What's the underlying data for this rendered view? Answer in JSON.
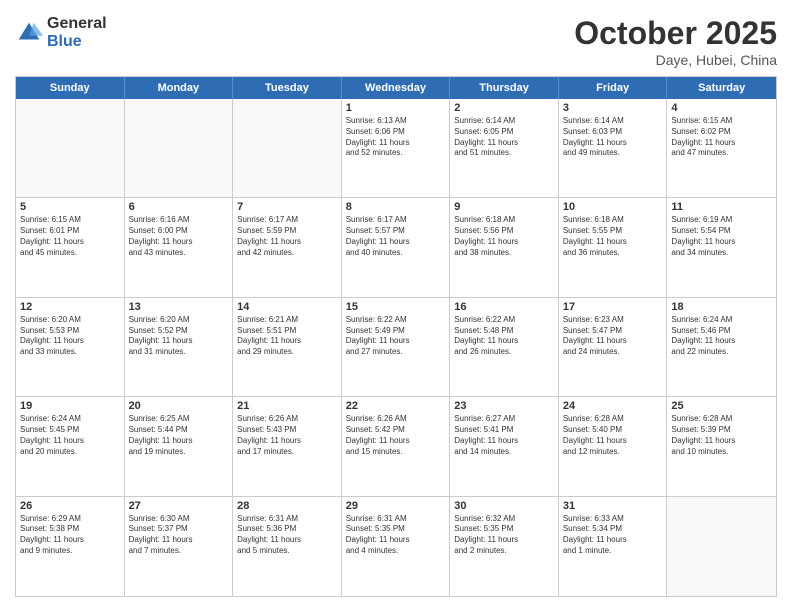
{
  "header": {
    "logo_general": "General",
    "logo_blue": "Blue",
    "month": "October 2025",
    "location": "Daye, Hubei, China"
  },
  "weekdays": [
    "Sunday",
    "Monday",
    "Tuesday",
    "Wednesday",
    "Thursday",
    "Friday",
    "Saturday"
  ],
  "weeks": [
    [
      {
        "day": "",
        "info": ""
      },
      {
        "day": "",
        "info": ""
      },
      {
        "day": "",
        "info": ""
      },
      {
        "day": "1",
        "info": "Sunrise: 6:13 AM\nSunset: 6:06 PM\nDaylight: 11 hours\nand 52 minutes."
      },
      {
        "day": "2",
        "info": "Sunrise: 6:14 AM\nSunset: 6:05 PM\nDaylight: 11 hours\nand 51 minutes."
      },
      {
        "day": "3",
        "info": "Sunrise: 6:14 AM\nSunset: 6:03 PM\nDaylight: 11 hours\nand 49 minutes."
      },
      {
        "day": "4",
        "info": "Sunrise: 6:15 AM\nSunset: 6:02 PM\nDaylight: 11 hours\nand 47 minutes."
      }
    ],
    [
      {
        "day": "5",
        "info": "Sunrise: 6:15 AM\nSunset: 6:01 PM\nDaylight: 11 hours\nand 45 minutes."
      },
      {
        "day": "6",
        "info": "Sunrise: 6:16 AM\nSunset: 6:00 PM\nDaylight: 11 hours\nand 43 minutes."
      },
      {
        "day": "7",
        "info": "Sunrise: 6:17 AM\nSunset: 5:59 PM\nDaylight: 11 hours\nand 42 minutes."
      },
      {
        "day": "8",
        "info": "Sunrise: 6:17 AM\nSunset: 5:57 PM\nDaylight: 11 hours\nand 40 minutes."
      },
      {
        "day": "9",
        "info": "Sunrise: 6:18 AM\nSunset: 5:56 PM\nDaylight: 11 hours\nand 38 minutes."
      },
      {
        "day": "10",
        "info": "Sunrise: 6:18 AM\nSunset: 5:55 PM\nDaylight: 11 hours\nand 36 minutes."
      },
      {
        "day": "11",
        "info": "Sunrise: 6:19 AM\nSunset: 5:54 PM\nDaylight: 11 hours\nand 34 minutes."
      }
    ],
    [
      {
        "day": "12",
        "info": "Sunrise: 6:20 AM\nSunset: 5:53 PM\nDaylight: 11 hours\nand 33 minutes."
      },
      {
        "day": "13",
        "info": "Sunrise: 6:20 AM\nSunset: 5:52 PM\nDaylight: 11 hours\nand 31 minutes."
      },
      {
        "day": "14",
        "info": "Sunrise: 6:21 AM\nSunset: 5:51 PM\nDaylight: 11 hours\nand 29 minutes."
      },
      {
        "day": "15",
        "info": "Sunrise: 6:22 AM\nSunset: 5:49 PM\nDaylight: 11 hours\nand 27 minutes."
      },
      {
        "day": "16",
        "info": "Sunrise: 6:22 AM\nSunset: 5:48 PM\nDaylight: 11 hours\nand 26 minutes."
      },
      {
        "day": "17",
        "info": "Sunrise: 6:23 AM\nSunset: 5:47 PM\nDaylight: 11 hours\nand 24 minutes."
      },
      {
        "day": "18",
        "info": "Sunrise: 6:24 AM\nSunset: 5:46 PM\nDaylight: 11 hours\nand 22 minutes."
      }
    ],
    [
      {
        "day": "19",
        "info": "Sunrise: 6:24 AM\nSunset: 5:45 PM\nDaylight: 11 hours\nand 20 minutes."
      },
      {
        "day": "20",
        "info": "Sunrise: 6:25 AM\nSunset: 5:44 PM\nDaylight: 11 hours\nand 19 minutes."
      },
      {
        "day": "21",
        "info": "Sunrise: 6:26 AM\nSunset: 5:43 PM\nDaylight: 11 hours\nand 17 minutes."
      },
      {
        "day": "22",
        "info": "Sunrise: 6:26 AM\nSunset: 5:42 PM\nDaylight: 11 hours\nand 15 minutes."
      },
      {
        "day": "23",
        "info": "Sunrise: 6:27 AM\nSunset: 5:41 PM\nDaylight: 11 hours\nand 14 minutes."
      },
      {
        "day": "24",
        "info": "Sunrise: 6:28 AM\nSunset: 5:40 PM\nDaylight: 11 hours\nand 12 minutes."
      },
      {
        "day": "25",
        "info": "Sunrise: 6:28 AM\nSunset: 5:39 PM\nDaylight: 11 hours\nand 10 minutes."
      }
    ],
    [
      {
        "day": "26",
        "info": "Sunrise: 6:29 AM\nSunset: 5:38 PM\nDaylight: 11 hours\nand 9 minutes."
      },
      {
        "day": "27",
        "info": "Sunrise: 6:30 AM\nSunset: 5:37 PM\nDaylight: 11 hours\nand 7 minutes."
      },
      {
        "day": "28",
        "info": "Sunrise: 6:31 AM\nSunset: 5:36 PM\nDaylight: 11 hours\nand 5 minutes."
      },
      {
        "day": "29",
        "info": "Sunrise: 6:31 AM\nSunset: 5:35 PM\nDaylight: 11 hours\nand 4 minutes."
      },
      {
        "day": "30",
        "info": "Sunrise: 6:32 AM\nSunset: 5:35 PM\nDaylight: 11 hours\nand 2 minutes."
      },
      {
        "day": "31",
        "info": "Sunrise: 6:33 AM\nSunset: 5:34 PM\nDaylight: 11 hours\nand 1 minute."
      },
      {
        "day": "",
        "info": ""
      }
    ]
  ]
}
